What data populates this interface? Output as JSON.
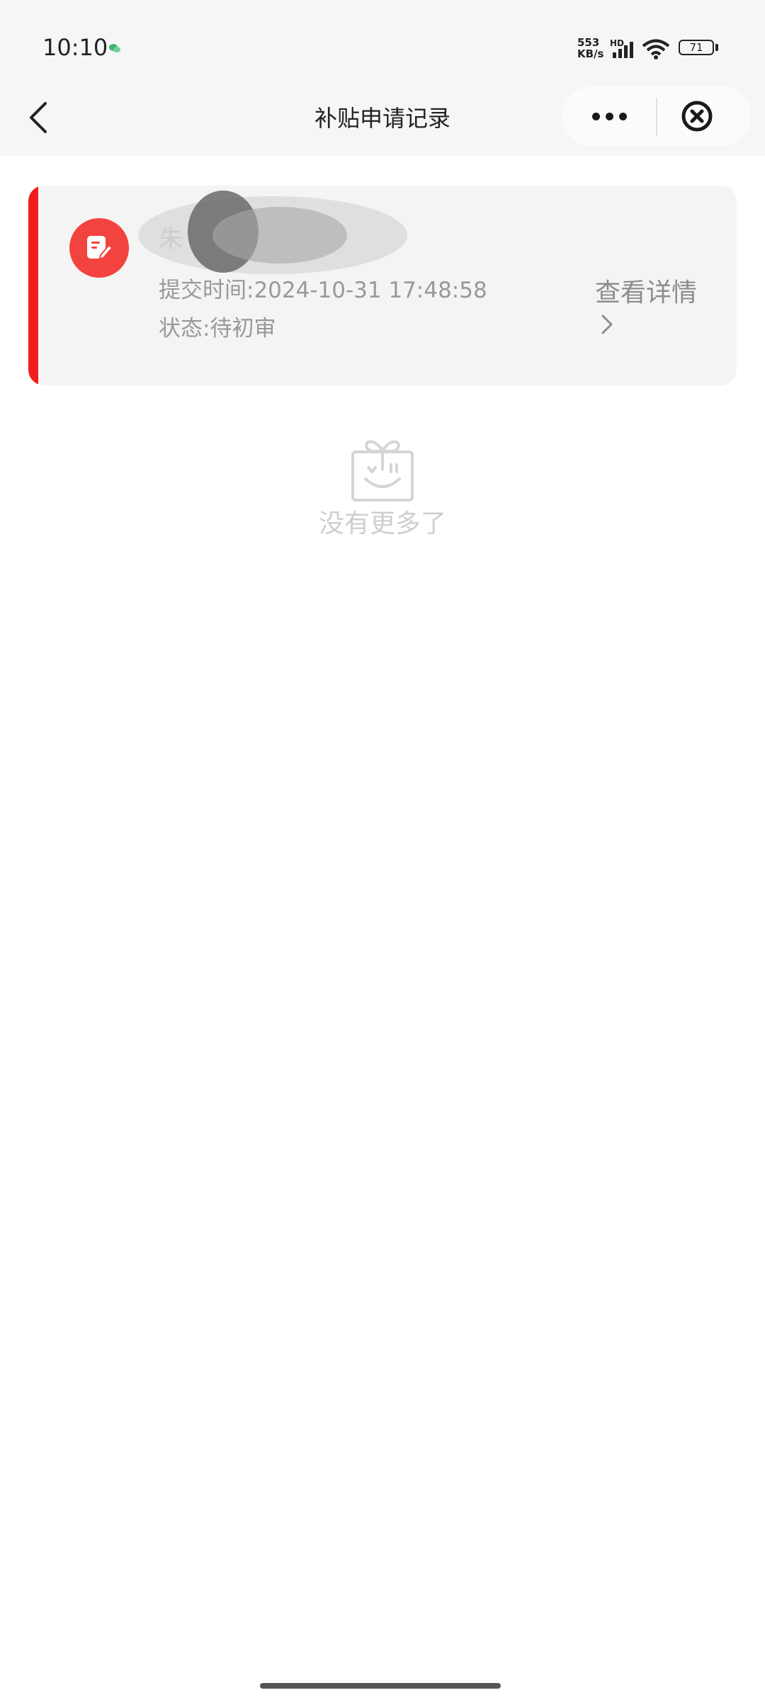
{
  "status_bar": {
    "time": "10:10",
    "net_speed_value": "553",
    "net_speed_unit": "KB/s",
    "network_label": "HD",
    "battery": "71"
  },
  "nav": {
    "title": "补贴申请记录"
  },
  "record": {
    "name": "朱",
    "submit_time": "提交时间:2024-10-31 17:48:58",
    "status": "状态:待初审",
    "detail_label": "查看详情"
  },
  "empty_state": {
    "text": "没有更多了"
  },
  "colors": {
    "accent": "#f11e1e",
    "icon_bg": "#f2433e"
  }
}
